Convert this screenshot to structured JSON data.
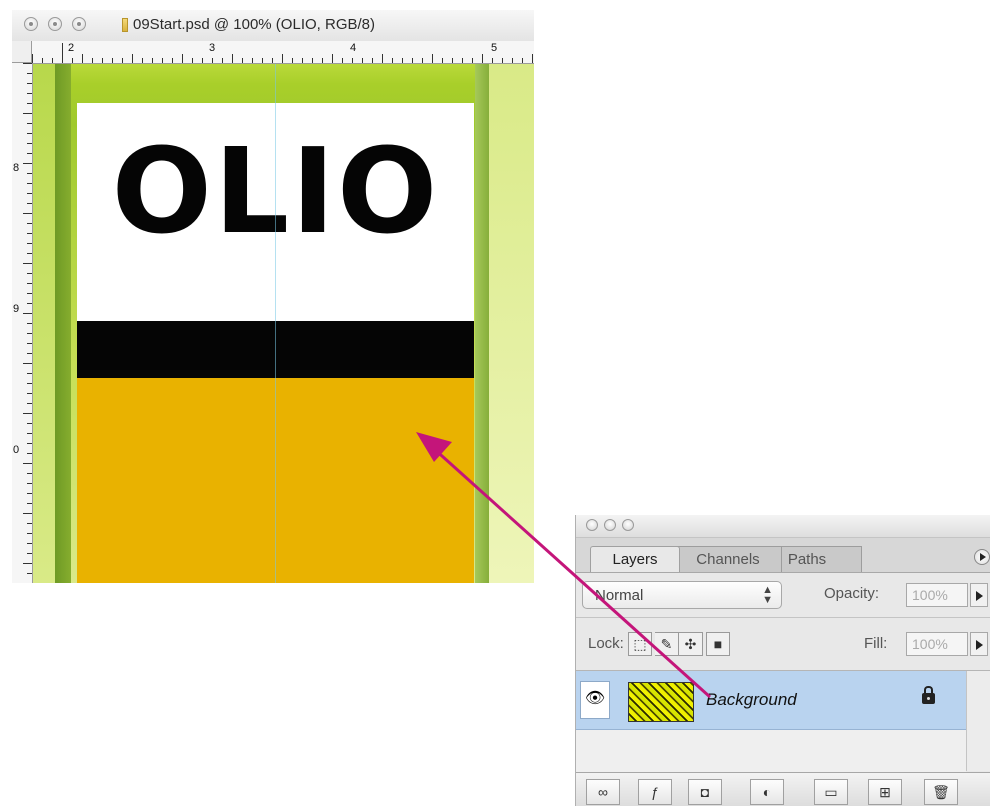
{
  "document": {
    "title": "09Start.psd @ 100% (OLIO, RGB/8)",
    "ruler_top_numbers": [
      "2",
      "3",
      "4",
      "5"
    ],
    "ruler_left_numbers": [
      "8",
      "9",
      "0"
    ],
    "artwork_text": "OLIO"
  },
  "layers_panel": {
    "tabs": [
      "Layers",
      "Channels",
      "Paths"
    ],
    "blend_mode": "Normal",
    "opacity_label": "Opacity:",
    "opacity_value": "100%",
    "lock_label": "Lock:",
    "fill_label": "Fill:",
    "fill_value": "100%",
    "layer": {
      "name": "Background"
    }
  },
  "colors": {
    "arrow": "#c4157a",
    "layer_selected": "#b9d3ef",
    "label_orange": "#e9b200"
  }
}
